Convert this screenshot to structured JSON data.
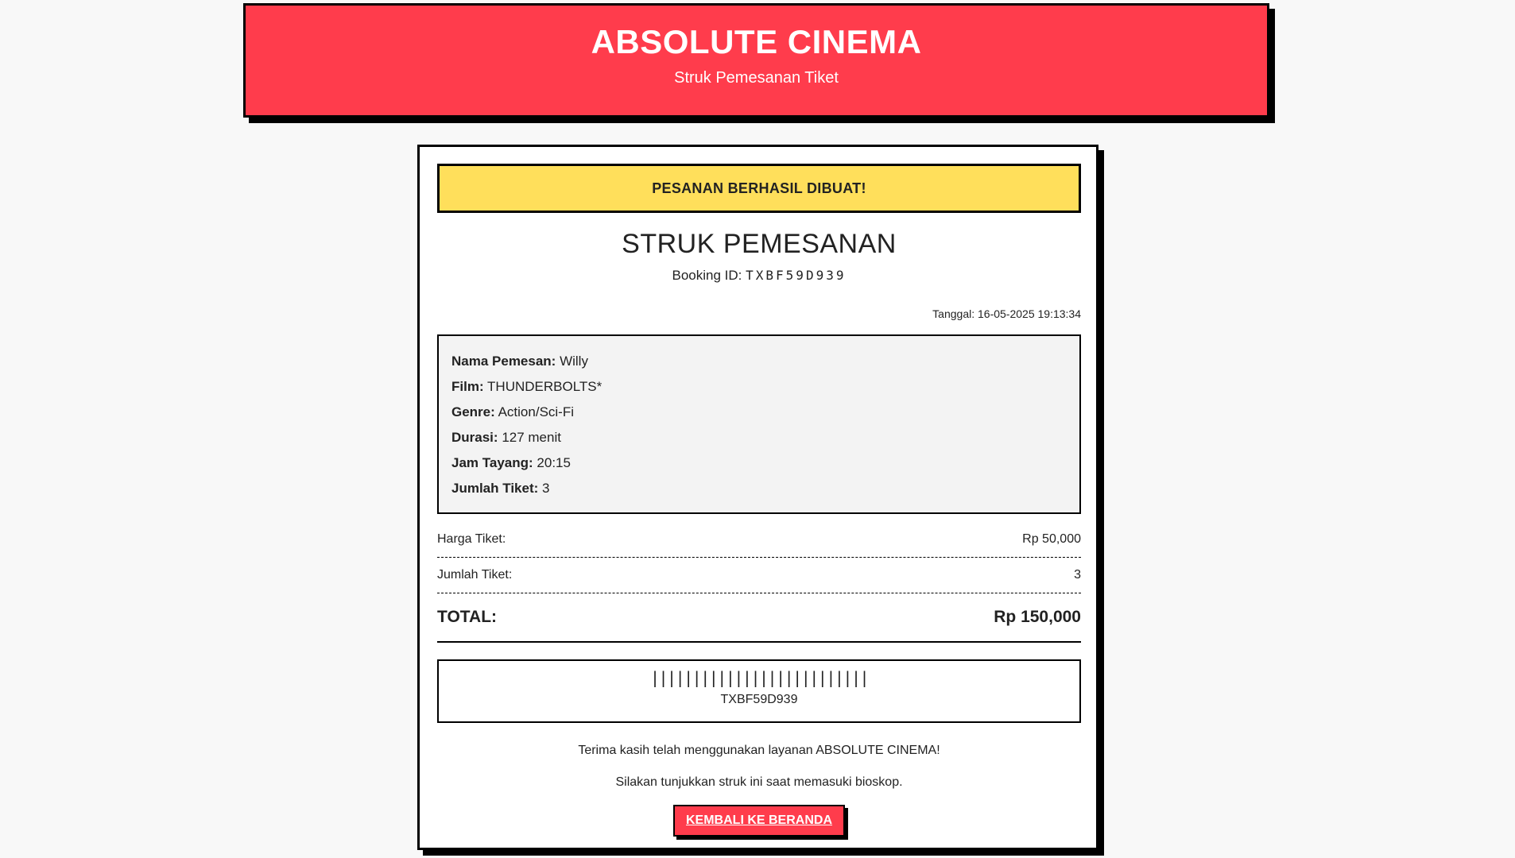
{
  "header": {
    "title": "ABSOLUTE CINEMA",
    "subtitle": "Struk Pemesanan Tiket"
  },
  "receipt": {
    "success_message": "PESANAN BERHASIL DIBUAT!",
    "title": "STRUK PEMESANAN",
    "booking_id_label": "Booking ID:",
    "booking_id": "TXBF59D939",
    "date_label": "Tanggal:",
    "date": "16-05-2025 19:13:34",
    "details": [
      {
        "label": "Nama Pemesan:",
        "value": "Willy"
      },
      {
        "label": "Film:",
        "value": "THUNDERBOLTS*"
      },
      {
        "label": "Genre:",
        "value": "Action/Sci-Fi"
      },
      {
        "label": "Durasi:",
        "value": "127 menit"
      },
      {
        "label": "Jam Tayang:",
        "value": "20:15"
      },
      {
        "label": "Jumlah Tiket:",
        "value": "3"
      }
    ],
    "price_label": "Harga Tiket:",
    "price_value": "Rp 50,000",
    "qty_label": "Jumlah Tiket:",
    "qty_value": "3",
    "total_label": "TOTAL:",
    "total_value": "Rp 150,000",
    "barcode_glyphs": "||||||||||||||||||||||||||",
    "barcode_code": "TXBF59D939",
    "thanks": "Terima kasih telah menggunakan layanan ABSOLUTE CINEMA!",
    "instruction": "Silakan tunjukkan struk ini saat memasuki bioskop.",
    "back_button": "KEMBALI KE BERANDA"
  },
  "colors": {
    "brand_red": "#ff3c4c",
    "success_yellow": "#ffdf5b",
    "details_bg": "#f3f3f3"
  }
}
